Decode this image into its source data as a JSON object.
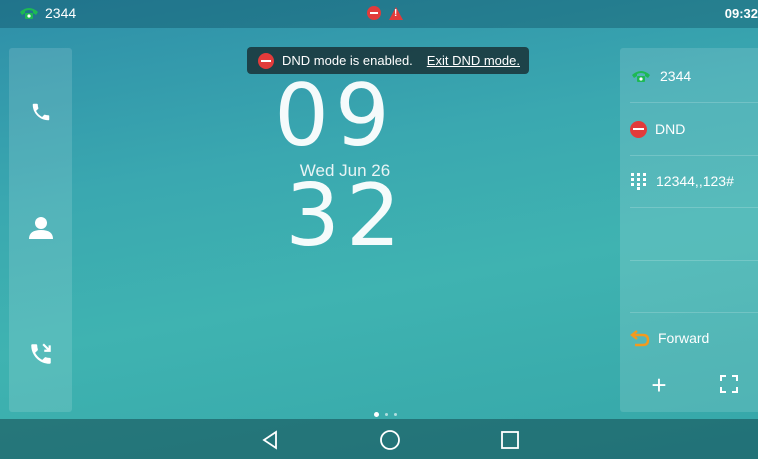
{
  "status_bar": {
    "line_label": "2344",
    "time": "09:32",
    "icons": [
      "phone-icon",
      "dnd-icon",
      "warning-icon"
    ]
  },
  "toast": {
    "message": "DND mode is enabled.",
    "link": "Exit DND mode."
  },
  "clock": {
    "hours": "09",
    "minutes": "32",
    "date": "Wed Jun 26"
  },
  "left_panel": {
    "items": [
      {
        "name": "phone-icon"
      },
      {
        "name": "contacts-icon"
      },
      {
        "name": "call-history-icon"
      }
    ]
  },
  "right_panel": {
    "items": [
      {
        "icon": "phone-icon",
        "label": "2344"
      },
      {
        "icon": "dnd-icon",
        "label": "DND"
      },
      {
        "icon": "dialpad-icon",
        "label": "12344,,123#"
      },
      {
        "icon": "",
        "label": ""
      },
      {
        "icon": "",
        "label": ""
      },
      {
        "icon": "forward-icon",
        "label": "Forward"
      }
    ],
    "add_label": "+"
  },
  "colors": {
    "accent_green": "#1db954",
    "dnd_red": "#e23b3b",
    "forward_orange": "#f39a1e"
  },
  "pager": {
    "pages": 3,
    "active": 1
  }
}
